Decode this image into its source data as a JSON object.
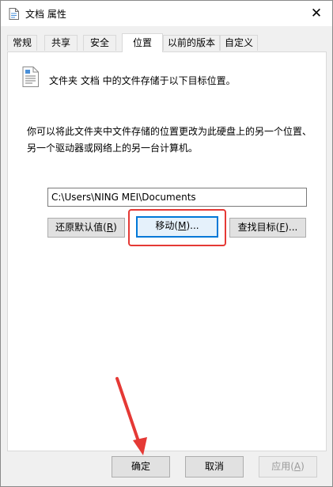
{
  "window": {
    "title": "文档 属性",
    "icon": "document-icon"
  },
  "tabs": [
    {
      "label": "常规"
    },
    {
      "label": "共享"
    },
    {
      "label": "安全"
    },
    {
      "label": "位置"
    },
    {
      "label": "以前的版本"
    },
    {
      "label": "自定义"
    }
  ],
  "active_tab": "位置",
  "location": {
    "heading": "文件夹 文档 中的文件存储于以下目标位置。",
    "description": "你可以将此文件夹中文件存储的位置更改为此硬盘上的另一个位置、另一个驱动器或网络上的另一台计算机。",
    "path": "C:\\Users\\NING MEI\\Documents",
    "buttons": {
      "restore": {
        "text": "还原默认值",
        "key": "R"
      },
      "move": {
        "text": "移动",
        "key": "M",
        "suffix": "..."
      },
      "find": {
        "text": "查找目标",
        "key": "F",
        "suffix": "..."
      }
    }
  },
  "footer": {
    "ok": "确定",
    "cancel": "取消",
    "apply": {
      "text": "应用",
      "key": "A"
    }
  },
  "colors": {
    "highlight": "#e53935",
    "focus": "#0078d7"
  }
}
